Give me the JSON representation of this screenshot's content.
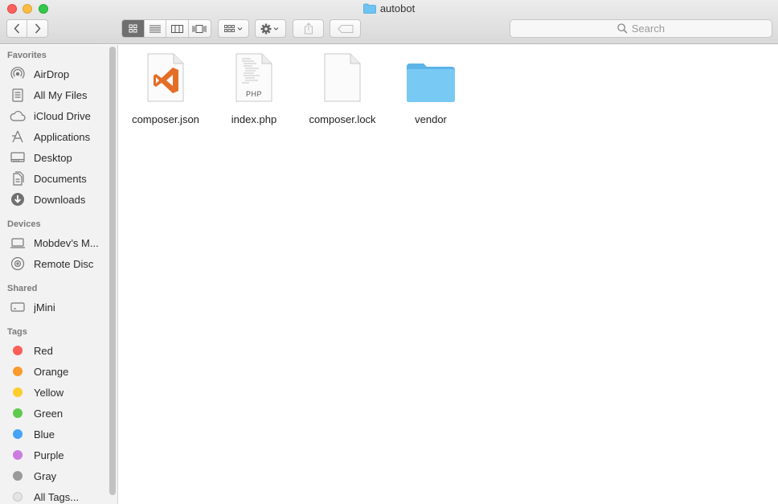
{
  "window": {
    "title": "autobot",
    "folder_color": "#5ab9ef"
  },
  "toolbar": {
    "back_icon": "chevron-left-icon",
    "forward_icon": "chevron-right-icon",
    "views": [
      "icon-view",
      "list-view",
      "column-view",
      "cover-flow-view"
    ],
    "active_view": "icon-view",
    "arrange_icon": "arrange-grid-icon",
    "action_icon": "gear-icon",
    "share_icon": "share-icon",
    "tag_icon": "tag-icon",
    "search_placeholder": "Search"
  },
  "sidebar": {
    "favorites_title": "Favorites",
    "favorites": [
      {
        "label": "AirDrop",
        "icon": "airdrop-icon"
      },
      {
        "label": "All My Files",
        "icon": "all-files-icon"
      },
      {
        "label": "iCloud Drive",
        "icon": "cloud-icon"
      },
      {
        "label": "Applications",
        "icon": "applications-icon"
      },
      {
        "label": "Desktop",
        "icon": "desktop-icon"
      },
      {
        "label": "Documents",
        "icon": "documents-icon"
      },
      {
        "label": "Downloads",
        "icon": "downloads-icon"
      }
    ],
    "devices_title": "Devices",
    "devices": [
      {
        "label": "Mobdev’s M...",
        "icon": "computer-icon"
      },
      {
        "label": "Remote Disc",
        "icon": "disc-icon"
      }
    ],
    "shared_title": "Shared",
    "shared": [
      {
        "label": "jMini",
        "icon": "server-icon"
      }
    ],
    "tags_title": "Tags",
    "tags": [
      {
        "label": "Red",
        "color": "#fc5e57"
      },
      {
        "label": "Orange",
        "color": "#f99b2c"
      },
      {
        "label": "Yellow",
        "color": "#fccd2e"
      },
      {
        "label": "Green",
        "color": "#5fc94e"
      },
      {
        "label": "Blue",
        "color": "#45a3f7"
      },
      {
        "label": "Purple",
        "color": "#cb7ae0"
      },
      {
        "label": "Gray",
        "color": "#9a9a9a"
      },
      {
        "label": "All Tags...",
        "color": "#e0e0e0"
      }
    ]
  },
  "files": [
    {
      "name": "composer.json",
      "icon": "vscode-document-icon"
    },
    {
      "name": "index.php",
      "icon": "php-document-icon",
      "badge": "PHP"
    },
    {
      "name": "composer.lock",
      "icon": "blank-document-icon"
    },
    {
      "name": "vendor",
      "icon": "folder-icon"
    }
  ]
}
